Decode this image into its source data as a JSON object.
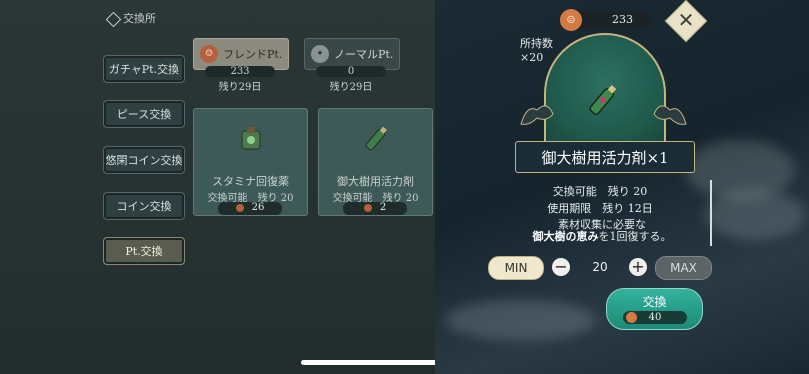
{
  "shop": {
    "title": "交換所"
  },
  "sidebar": {
    "items": [
      {
        "label": "ガチャPt.交換"
      },
      {
        "label": "ピース交換"
      },
      {
        "label": "悠閑コイン交換"
      },
      {
        "label": "コイン交換"
      },
      {
        "label": "Pt.交換"
      }
    ],
    "active_index": 4
  },
  "pt_tabs": [
    {
      "label": "フレンドPt.",
      "icon": "friend-pt-coin-icon",
      "count": "233",
      "remaining": "残り29日"
    },
    {
      "label": "ノーマルPt.",
      "icon": "normal-pt-coin-icon",
      "count": "0",
      "remaining": "残り29日"
    }
  ],
  "cards": [
    {
      "name": "スタミナ回復薬",
      "stock": "交換可能　残り 20",
      "price": "26",
      "icon": "stamina-potion-icon"
    },
    {
      "name": "御大樹用活力剤",
      "stock": "交換可能　残り 20",
      "price": "2",
      "icon": "vitality-bottle-icon"
    }
  ],
  "overlay": {
    "points": "233",
    "owned_label": "所持数",
    "owned_count": "×20",
    "item_name": "御大樹用活力剤×1",
    "available": "交換可能　残り 20",
    "expiry": "使用期限　残り 12日",
    "desc_line1": "素材収集に必要な",
    "desc_bold": "御大樹の恵み",
    "desc_line2": "を1回復する。",
    "quantity": "20",
    "min_label": "MIN",
    "max_label": "MAX",
    "minus_label": "−",
    "plus_label": "+",
    "exchange_label": "交換",
    "exchange_cost": "40",
    "close_label": "✕"
  },
  "colors": {
    "accent_gold": "#c6b57f",
    "exchange_green": "#1c8a76",
    "coin_orange": "#d37a45"
  }
}
